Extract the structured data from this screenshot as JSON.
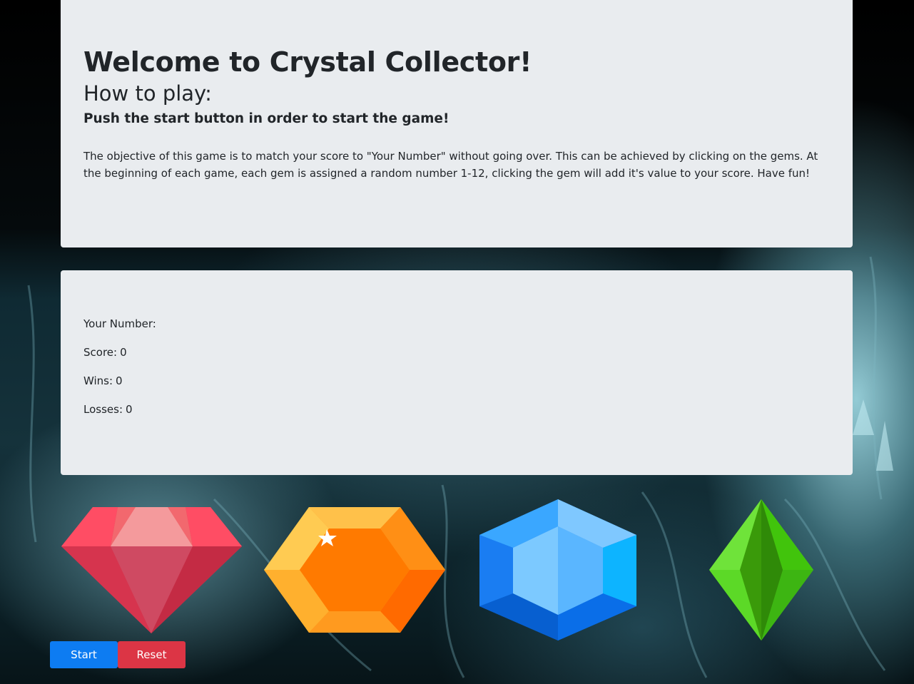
{
  "intro": {
    "title": "Welcome to Crystal Collector!",
    "how_to_title": "How to play:",
    "start_hint": "Push the start button in order to start the game!",
    "objective": "The objective of this game is to match your score to \"Your Number\" without going over. This can be achieved by clicking on the gems. At the beginning of each game, each gem is assigned a random number 1-12, clicking the gem will add it's value to your score. Have fun!"
  },
  "stats": {
    "your_number_label": "Your Number:",
    "your_number_value": "",
    "score_label": "Score:",
    "score_value": "0",
    "wins_label": "Wins:",
    "wins_value": "0",
    "losses_label": "Losses:",
    "losses_value": "0"
  },
  "gems": [
    {
      "name": "red",
      "icon": "red-diamond-gem-icon",
      "color": "#e63950"
    },
    {
      "name": "orange",
      "icon": "orange-hexagon-gem-icon",
      "color": "#ff7b0a"
    },
    {
      "name": "blue",
      "icon": "blue-hexagon-gem-icon",
      "color": "#1a8cff"
    },
    {
      "name": "green",
      "icon": "green-rhombus-gem-icon",
      "color": "#3fbf10"
    }
  ],
  "buttons": {
    "start_label": "Start",
    "reset_label": "Reset"
  },
  "colors": {
    "panel": "#e9ecef",
    "start": "#0d7cf2",
    "reset": "#dc3545"
  }
}
